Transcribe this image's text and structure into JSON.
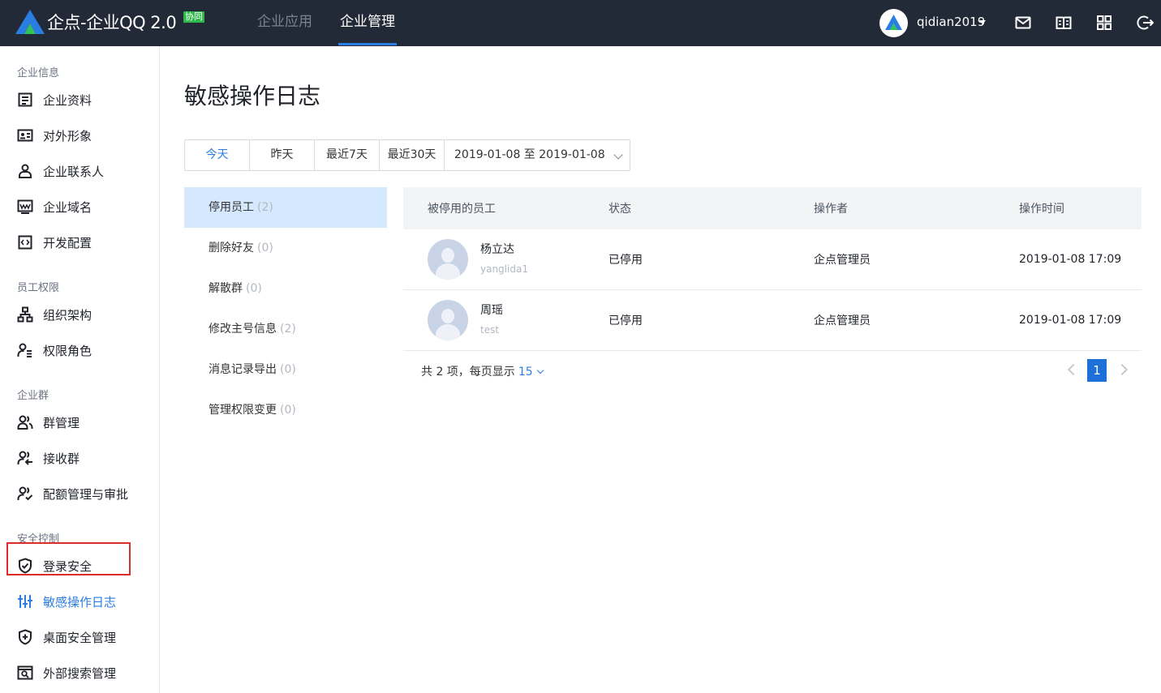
{
  "header": {
    "brand": "企点-企业QQ 2.0",
    "brand_badge": "协同",
    "nav": [
      {
        "label": "企业应用",
        "active": false
      },
      {
        "label": "企业管理",
        "active": true
      }
    ],
    "user": "qidian2019",
    "icons": [
      "mail-icon",
      "book-icon",
      "grid-icon",
      "logout-icon"
    ]
  },
  "sidebar": {
    "groups": [
      {
        "title": "企业信息",
        "items": [
          "企业资料",
          "对外形象",
          "企业联系人",
          "企业域名",
          "开发配置"
        ]
      },
      {
        "title": "员工权限",
        "items": [
          "组织架构",
          "权限角色"
        ]
      },
      {
        "title": "企业群",
        "items": [
          "群管理",
          "接收群",
          "配额管理与审批"
        ]
      },
      {
        "title": "安全控制",
        "items": [
          "登录安全",
          "敏感操作日志",
          "桌面安全管理",
          "外部搜索管理"
        ]
      }
    ],
    "active_item": "敏感操作日志"
  },
  "main": {
    "title": "敏感操作日志",
    "range_buttons": [
      "今天",
      "昨天",
      "最近7天",
      "最近30天"
    ],
    "active_range": "今天",
    "date_range": "2019-01-08 至 2019-01-08",
    "categories": [
      {
        "label": "停用员工",
        "count": "(2)"
      },
      {
        "label": "删除好友",
        "count": "(0)"
      },
      {
        "label": "解散群",
        "count": "(0)"
      },
      {
        "label": "修改主号信息",
        "count": "(2)"
      },
      {
        "label": "消息记录导出",
        "count": "(0)"
      },
      {
        "label": "管理权限变更",
        "count": "(0)"
      }
    ],
    "active_category": "停用员工",
    "table": {
      "columns": [
        "被停用的员工",
        "状态",
        "操作者",
        "操作时间"
      ],
      "rows": [
        {
          "name": "杨立达",
          "id": "yanglida1",
          "status": "已停用",
          "operator": "企点管理员",
          "time": "2019-01-08 17:09"
        },
        {
          "name": "周瑶",
          "id": "test",
          "status": "已停用",
          "operator": "企点管理员",
          "time": "2019-01-08 17:09"
        }
      ]
    },
    "footer": {
      "summary": "共 2 项，每页显示",
      "page_size": "15",
      "current_page": "1"
    }
  },
  "colors": {
    "topbar": "#232a37",
    "accent": "#2a7de1",
    "active_category_bg": "#d6e8fd",
    "highlight_border": "#e02b2b"
  }
}
